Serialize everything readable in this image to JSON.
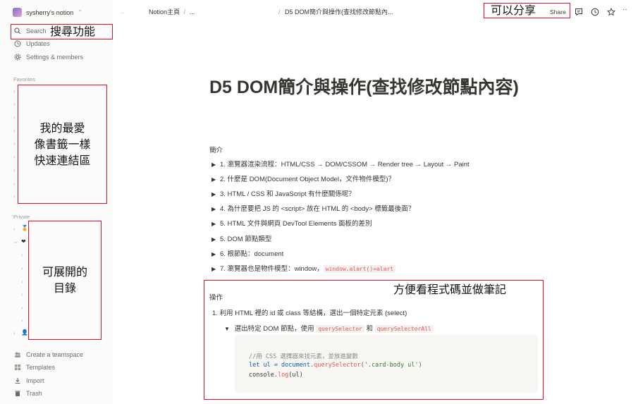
{
  "sidebar": {
    "workspace_name": "sysherry's notion",
    "nav": [
      {
        "label": "Search",
        "icon": "search-icon"
      },
      {
        "label": "Updates",
        "icon": "clock-icon"
      },
      {
        "label": "Settings & members",
        "icon": "gear-icon"
      }
    ],
    "favorites_label": "Favorites",
    "private_label": "Private",
    "bottom": [
      {
        "label": "Create a teamspace",
        "icon": "teamspace-icon"
      },
      {
        "label": "Templates",
        "icon": "templates-icon"
      },
      {
        "label": "Import",
        "icon": "import-icon"
      },
      {
        "label": "Trash",
        "icon": "trash-icon"
      }
    ]
  },
  "topbar": {
    "breadcrumb_1": "Notion主頁",
    "breadcrumb_sep": "/",
    "breadcrumb_ellipsis": "...",
    "breadcrumb_current": "D5 DOM簡介與操作(查找修改節點內...",
    "share_label": "Share"
  },
  "annotations": {
    "search": "搜尋功能",
    "share": "可以分享",
    "favorites": "我的最愛\n像書籤一樣\n快速連結區",
    "private": "可展開的\n目錄",
    "code": "方便看程式碼並做筆記"
  },
  "page": {
    "title": "D5 DOM簡介與操作(查找修改節點內容)",
    "intro_heading": "簡介",
    "toggles": [
      "1. 瀏覽器渲染流程：HTML/CSS → DOM/CSSOM → Render tree → Layout → Paint",
      "2. 什麼是 DOM(Document Object Model，文件物件模型)？",
      "3. HTML / CSS 和 JavaScript 有什麼關係呢？",
      "4. 為什麼要把 JS 的 <script> 放在 HTML 的 <body> 標籤最後面？",
      "5. HTML 文件與網頁 DevTool Elements 面板的差別",
      "5. DOM 節點類型",
      "6. 根節點：document",
      "7. 瀏覽器也是物件模型：window，"
    ],
    "toggle7_code": "window.alart()=alart",
    "ops_heading": "操作",
    "ops_item1": "1. 利用 HTML 裡的 id 或 class 等結構，選出一個特定元素 (select)",
    "ops_sub_text": "選出特定 DOM 節點，使用",
    "ops_sub_code1": "querySelector",
    "ops_sub_and": "和",
    "ops_sub_code2": "querySelectorAll",
    "code_line1": "//用 CSS 選擇器來找元素，並放進變數",
    "code_line2_a": "let ul = document.",
    "code_line2_b": "querySelector",
    "code_line2_c": "('.card-body ul')",
    "code_line3_a": "console.",
    "code_line3_b": "log",
    "code_line3_c": "(ul)"
  },
  "colors": {
    "annotation_border": "#e0102a",
    "code_red": "#eb5757"
  }
}
